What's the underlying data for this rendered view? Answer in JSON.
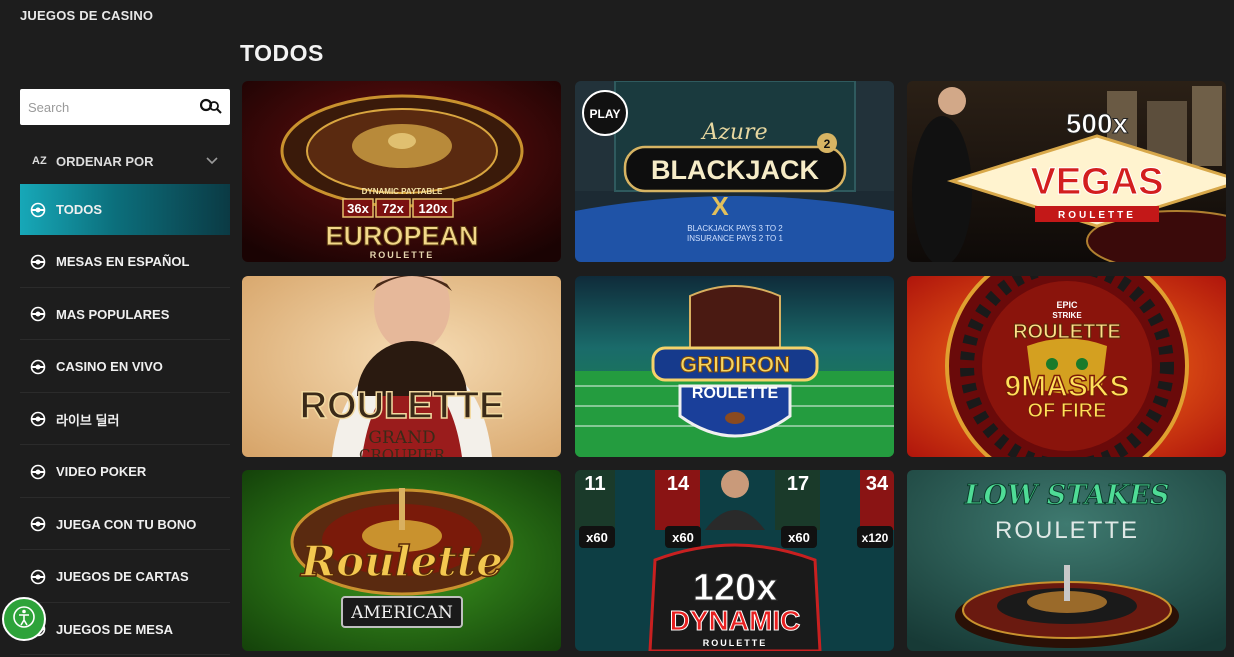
{
  "header": {
    "title": "JUEGOS DE CASINO"
  },
  "section": {
    "title": "TODOS"
  },
  "search": {
    "placeholder": "Search"
  },
  "sort": {
    "az": "AZ",
    "label": "ORDENAR POR"
  },
  "categories": [
    {
      "label": "TODOS",
      "active": true
    },
    {
      "label": "MESAS EN ESPAÑOL"
    },
    {
      "label": "MAS POPULARES"
    },
    {
      "label": "CASINO EN VIVO"
    },
    {
      "label": "라이브 딜러"
    },
    {
      "label": "VIDEO POKER"
    },
    {
      "label": "JUEGA CON TU BONO"
    },
    {
      "label": "JUEGOS DE CARTAS"
    },
    {
      "label": "JUEGOS DE MESA"
    }
  ],
  "games": [
    {
      "line1": "DYNAMIC PAYTABLE",
      "m1": "36x",
      "m2": "72x",
      "m3": "120x",
      "title": "EUROPEAN",
      "sub": "ROULETTE"
    },
    {
      "badge": "PLAY",
      "line1": "Azure",
      "title": "BLACKJACK",
      "x": "X",
      "sup": "2",
      "table1": "BLACKJACK PAYS 3 TO 2",
      "table2": "INSURANCE PAYS 2 TO 1"
    },
    {
      "line1": "500x",
      "title": "VEGAS",
      "sub": "ROULETTE"
    },
    {
      "title": "ROULETTE",
      "sub1": "GRAND",
      "sub2": "CROUPIER"
    },
    {
      "title": "GRIDIRON",
      "sub": "ROULETTE"
    },
    {
      "small1": "EPIC",
      "small2": "STRIKE",
      "line1": "ROULETTE",
      "title": "9MASKS",
      "sub": "OF FIRE"
    },
    {
      "title": "Roulette",
      "sub": "AMERICAN"
    },
    {
      "n1": "11",
      "n2": "14",
      "n3": "17",
      "n4": "34",
      "c1": "x60",
      "c2": "x60",
      "c3": "x60",
      "c4": "x120",
      "line1": "120x",
      "title": "DYNAMIC",
      "sub": "ROULETTE"
    },
    {
      "line1": "LOW STAKES",
      "title": "ROULETTE"
    }
  ],
  "colors": {
    "accent": "#17a8b8",
    "bg": "#1d1d1d",
    "a11y": "#2ea33a"
  },
  "icons": {
    "search": "search-icon",
    "chevron": "chevron-down-icon",
    "category": "category-icon",
    "accessibility": "accessibility-icon"
  }
}
